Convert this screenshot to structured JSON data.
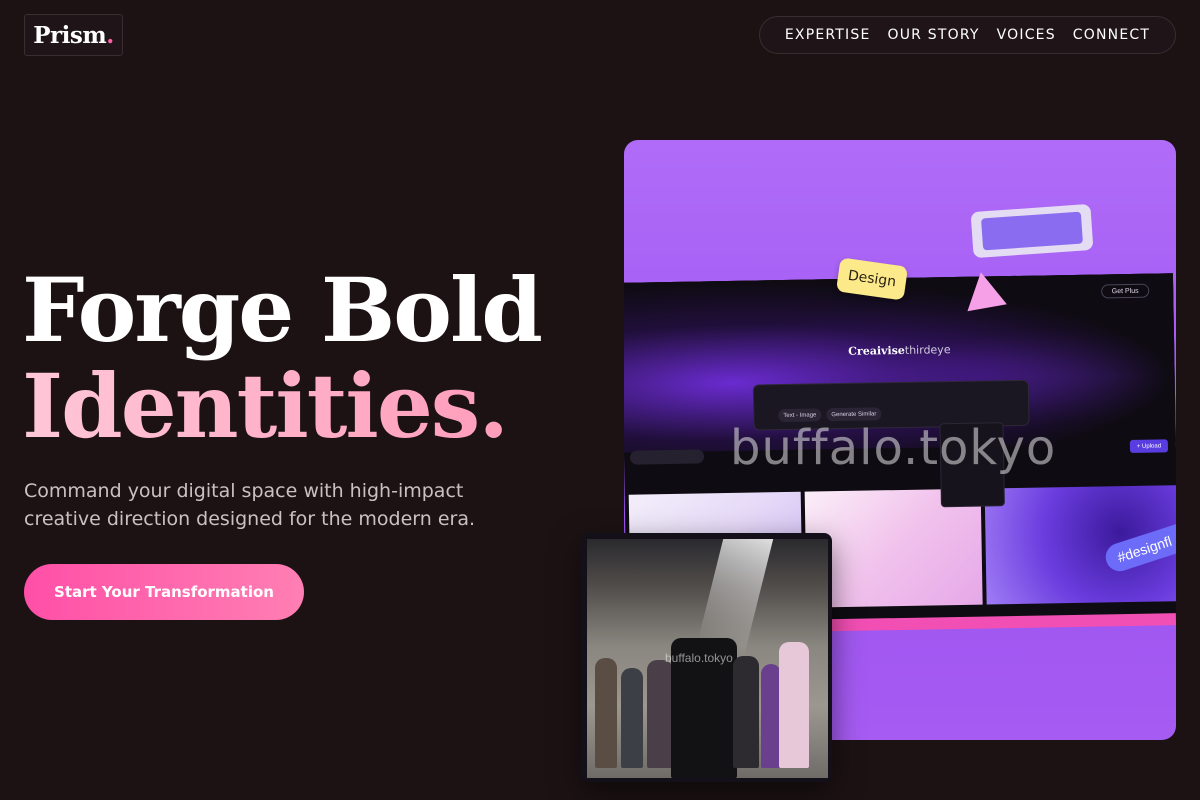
{
  "header": {
    "logo_text": "Prism",
    "logo_dot": ".",
    "nav": [
      "EXPERTISE",
      "OUR STORY",
      "VOICES",
      "CONNECT"
    ]
  },
  "hero": {
    "headline_line1": "Forge Bold",
    "headline_line2": "Identities.",
    "subcopy": "Command your digital space with high-impact creative direction designed for the modern era.",
    "cta_label": "Start Your Transformation"
  },
  "showcase": {
    "design_sticker": "Design",
    "brand_bold": "Creaivise",
    "brand_light": "thirdeye",
    "get_plus": "Get Plus",
    "prompt_pills": [
      "Text - Image",
      "Generate Similar"
    ],
    "upload": "+ Upload",
    "hashtag": "#designfl",
    "watermark": "buffalo.tokyo"
  },
  "photo": {
    "watermark": "buffalo.tokyo"
  },
  "colors": {
    "background": "#1c1214",
    "accent_pink": "#ff4fa7",
    "headline_pink": "#ffb2c8",
    "showcase_purple": "#a65cf2"
  }
}
